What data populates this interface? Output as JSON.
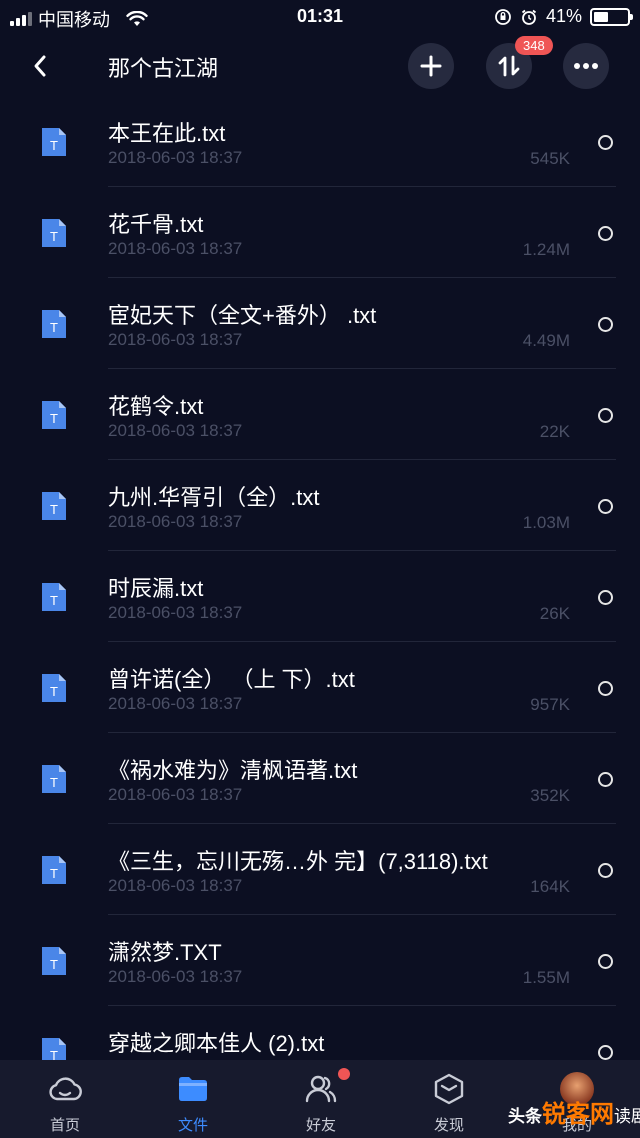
{
  "status_bar": {
    "carrier": "中国移动",
    "time": "01:31",
    "battery": "41%",
    "battery_level": 0.41
  },
  "nav": {
    "title": "那个古江湖",
    "transfer_badge": "348",
    "icons": {
      "back": "chevron-left-icon",
      "add": "plus-icon",
      "transfer": "up-down-arrows-icon",
      "more": "ellipsis-icon"
    }
  },
  "files": [
    {
      "name": "本王在此.txt",
      "date": "2018-06-03 18:37",
      "size": "545K"
    },
    {
      "name": "花千骨.txt",
      "date": "2018-06-03 18:37",
      "size": "1.24M"
    },
    {
      "name": "宦妃天下（全文+番外） .txt",
      "date": "2018-06-03 18:37",
      "size": "4.49M"
    },
    {
      "name": "花鹤令.txt",
      "date": "2018-06-03 18:37",
      "size": "22K"
    },
    {
      "name": "九州.华胥引（全）.txt",
      "date": "2018-06-03 18:37",
      "size": "1.03M"
    },
    {
      "name": "时辰漏.txt",
      "date": "2018-06-03 18:37",
      "size": "26K"
    },
    {
      "name": "曾许诺(全） （上 下）.txt",
      "date": "2018-06-03 18:37",
      "size": "957K"
    },
    {
      "name": "《祸水难为》清枫语著.txt",
      "date": "2018-06-03 18:37",
      "size": "352K"
    },
    {
      "name": "《三生，忘川无殇…外 完】(7,3118).txt",
      "date": "2018-06-03 18:37",
      "size": "164K"
    },
    {
      "name": "潇然梦.TXT",
      "date": "2018-06-03 18:37",
      "size": "1.55M"
    },
    {
      "name": "穿越之卿本佳人 (2).txt",
      "date": "",
      "size": ""
    }
  ],
  "file_icon_letter": "T",
  "tabs": [
    {
      "label": "首页",
      "icon": "cloud-icon"
    },
    {
      "label": "文件",
      "icon": "folder-icon"
    },
    {
      "label": "好友",
      "icon": "friends-icon"
    },
    {
      "label": "发现",
      "icon": "cube-icon"
    },
    {
      "label": "我的",
      "icon": "avatar"
    }
  ],
  "watermark": {
    "part1": "头条",
    "part2": "锐客网",
    "part3": "读剧"
  },
  "colors": {
    "background": "#0c0f22",
    "accent": "#3d8cff",
    "badge": "#ef5555",
    "file_icon": "#4a86e8"
  }
}
